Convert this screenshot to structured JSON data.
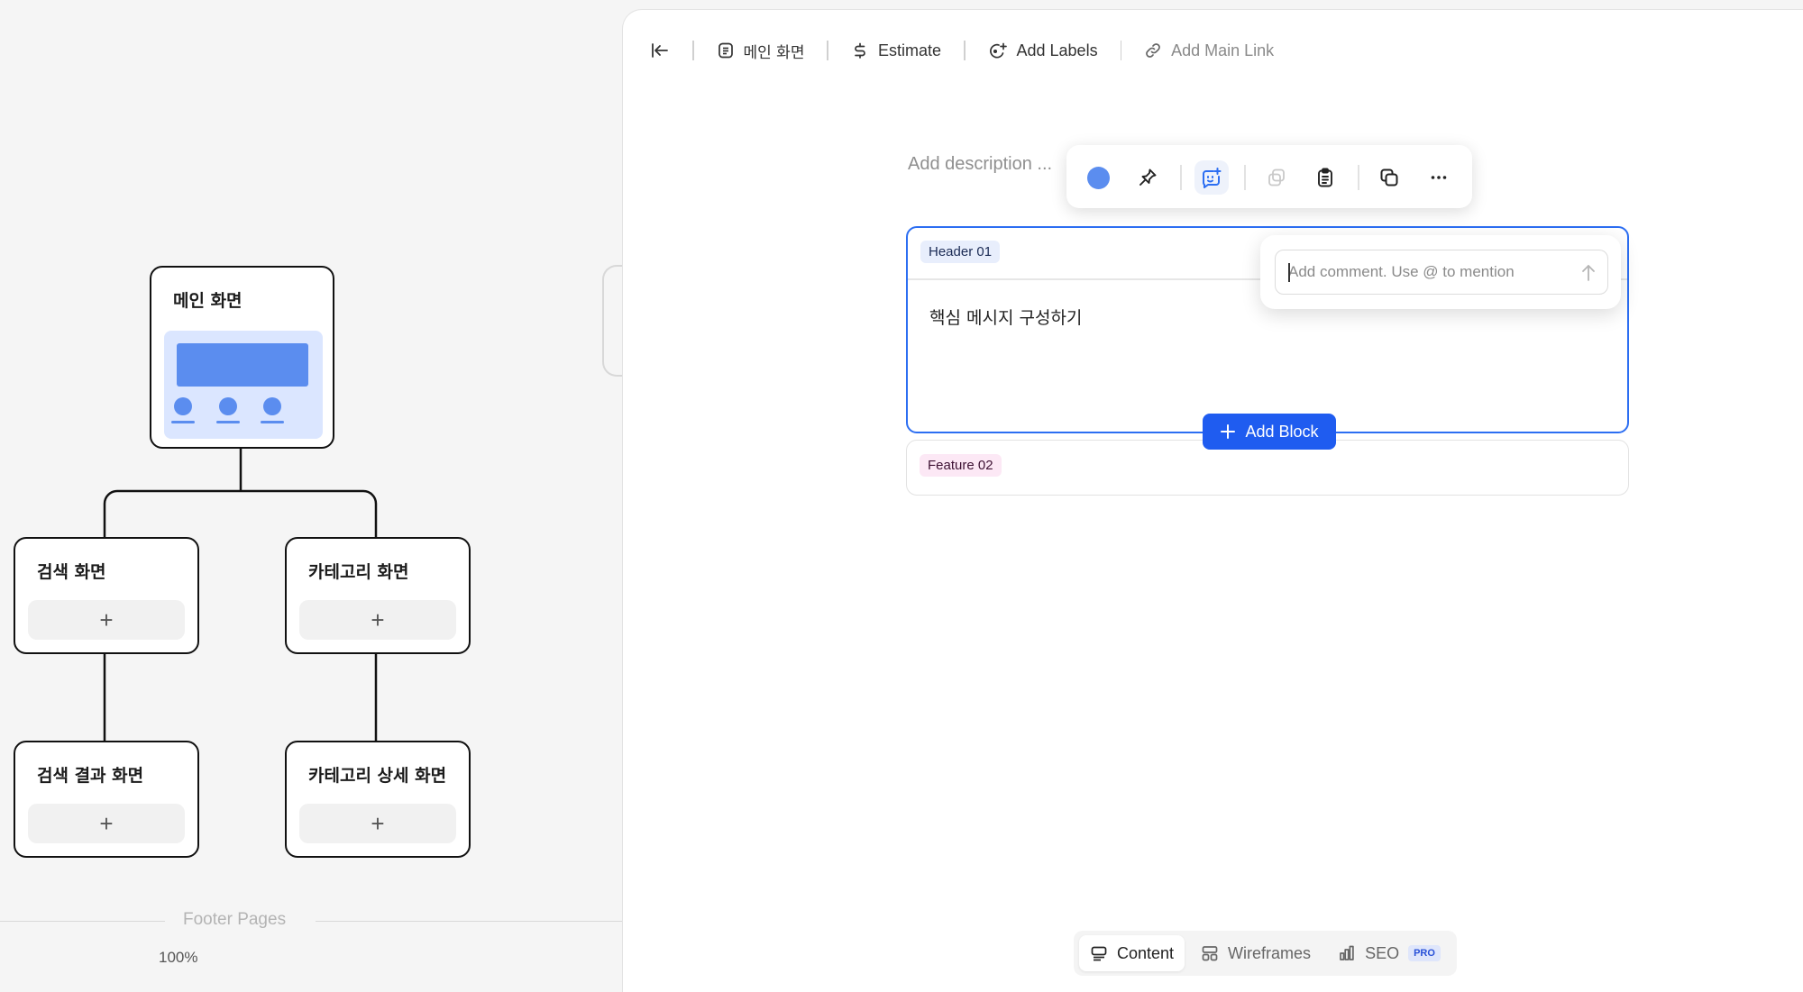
{
  "sitemap": {
    "nodes": [
      {
        "title": "메인 화면"
      },
      {
        "title": "검색 화면",
        "add": "+"
      },
      {
        "title": "카테고리 화면",
        "add": "+"
      },
      {
        "title": "검색 결과 화면",
        "add": "+"
      },
      {
        "title": "카테고리 상세 화면",
        "add": "+"
      }
    ],
    "footer_label": "Footer Pages",
    "zoom": "100%"
  },
  "toolbar": {
    "collapse_icon": "collapse-left-icon",
    "page_name": "메인 화면",
    "estimate": "Estimate",
    "add_labels": "Add Labels",
    "add_main_link": "Add Main Link"
  },
  "editor": {
    "description_placeholder": "Add description ...",
    "floating_toolbar": {
      "color": "#5b8def",
      "icons": [
        "color-dot-icon",
        "pin-icon",
        "add-comment-icon",
        "copy-style-icon",
        "clipboard-icon",
        "duplicate-icon",
        "more-icon"
      ]
    },
    "blocks": [
      {
        "tag": "Header 01",
        "text": "핵심 메시지 구성하기"
      },
      {
        "tag": "Feature 02"
      }
    ],
    "add_block": "Add Block",
    "comment_placeholder": "Add comment. Use @ to mention"
  },
  "bottom_tabs": [
    {
      "label": "Content",
      "active": true
    },
    {
      "label": "Wireframes"
    },
    {
      "label": "SEO",
      "badge": "PRO"
    }
  ],
  "colors": {
    "accent": "#1f5cf0",
    "selection": "#2c6ef2",
    "thumbnail": "#5b8def"
  }
}
